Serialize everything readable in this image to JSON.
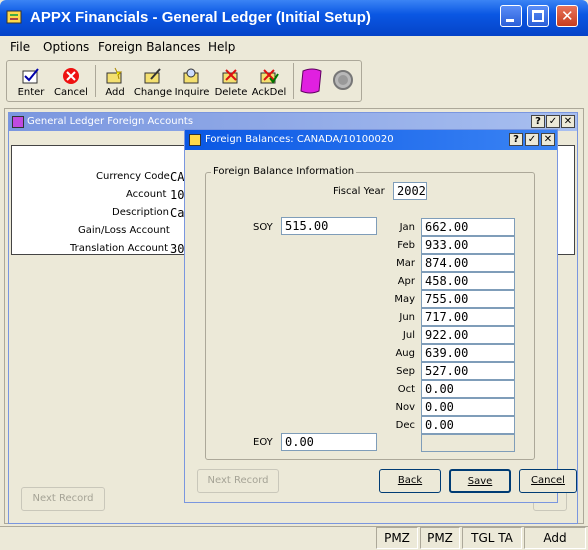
{
  "window": {
    "title": "APPX Financials - General Ledger (Initial Setup)"
  },
  "menu": [
    "File",
    "Options",
    "Foreign Balances",
    "Help"
  ],
  "toolbar": [
    {
      "label": "Enter",
      "icon": "enter-icon"
    },
    {
      "label": "Cancel",
      "icon": "cancel-icon"
    },
    {
      "label": "Add",
      "icon": "add-icon"
    },
    {
      "label": "Change",
      "icon": "change-icon"
    },
    {
      "label": "Inquire",
      "icon": "inquire-icon"
    },
    {
      "label": "Delete",
      "icon": "delete-icon"
    },
    {
      "label": "AckDel",
      "icon": "ackdel-icon"
    }
  ],
  "back_window": {
    "title": "General Ledger Foreign Accounts",
    "fields": [
      {
        "label": "Currency Code",
        "value": "CA"
      },
      {
        "label": "Account",
        "value": "10"
      },
      {
        "label": "Description",
        "value": "Ca"
      },
      {
        "label": "Gain/Loss Account",
        "value": ""
      },
      {
        "label": "Translation Account",
        "value": "30"
      }
    ],
    "next_record": "Next Record"
  },
  "dialog": {
    "title": "Foreign Balances: CANADA/10100020",
    "group_label": "Foreign Balance Information",
    "fiscal_year_label": "Fiscal Year",
    "fiscal_year": "2002",
    "soy_label": "SOY",
    "soy": "515.00",
    "eoy_label": "EOY",
    "eoy": "0.00",
    "months": [
      {
        "label": "Jan",
        "value": "662.00"
      },
      {
        "label": "Feb",
        "value": "933.00"
      },
      {
        "label": "Mar",
        "value": "874.00"
      },
      {
        "label": "Apr",
        "value": "458.00"
      },
      {
        "label": "May",
        "value": "755.00"
      },
      {
        "label": "Jun",
        "value": "717.00"
      },
      {
        "label": "Jul",
        "value": "922.00"
      },
      {
        "label": "Aug",
        "value": "639.00"
      },
      {
        "label": "Sep",
        "value": "527.00"
      },
      {
        "label": "Oct",
        "value": "0.00"
      },
      {
        "label": "Nov",
        "value": "0.00"
      },
      {
        "label": "Dec",
        "value": "0.00"
      }
    ],
    "buttons": {
      "next_record": "Next Record",
      "back": "Back",
      "save": "Save",
      "cancel": "Cancel"
    }
  },
  "status_bar": [
    "PMZ",
    "PMZ",
    "TGL TA",
    "Add"
  ],
  "colors": {
    "title_bar": "#0a57e3",
    "inner_title": "#7a96df",
    "accent": "#c04ae0"
  }
}
